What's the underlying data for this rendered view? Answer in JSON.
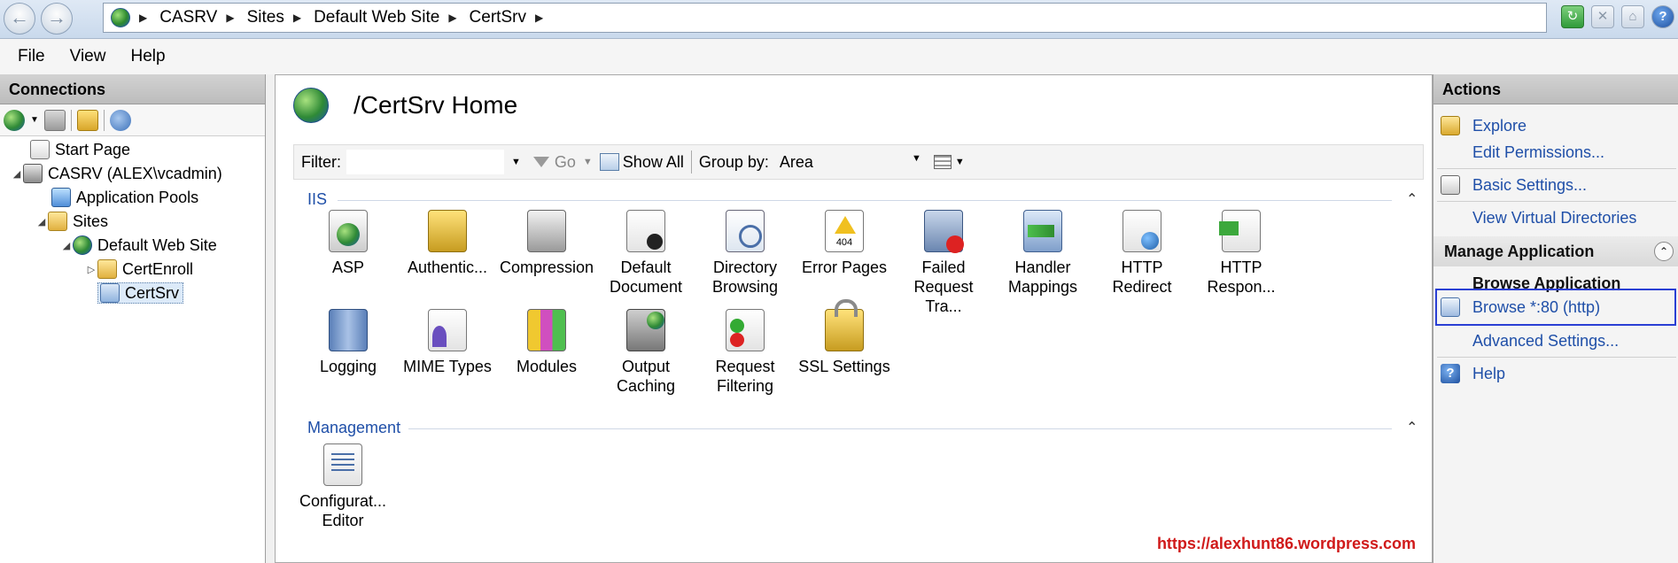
{
  "address_bar": {
    "breadcrumbs": [
      "CASRV",
      "Sites",
      "Default Web Site",
      "CertSrv"
    ]
  },
  "menu": [
    "File",
    "View",
    "Help"
  ],
  "connections": {
    "title": "Connections",
    "tree": [
      {
        "label": "Start Page",
        "icon": "page-icon"
      },
      {
        "label": "CASRV (ALEX\\vcadmin)",
        "icon": "server-icon"
      },
      {
        "label": "Application Pools",
        "icon": "app-pool-icon"
      },
      {
        "label": "Sites",
        "icon": "folder-icon"
      },
      {
        "label": "Default Web Site",
        "icon": "globe-icon"
      },
      {
        "label": "CertEnroll",
        "icon": "folder-icon"
      },
      {
        "label": "CertSrv",
        "icon": "application-icon"
      }
    ]
  },
  "center": {
    "title": "/CertSrv Home",
    "filter": {
      "label": "Filter:",
      "value": "",
      "go_label": "Go",
      "show_all_label": "Show All",
      "group_by_label": "Group by:",
      "group_by_value": "Area"
    },
    "sections": [
      {
        "name": "IIS",
        "features": [
          {
            "label": "ASP",
            "icon": "asp-icon"
          },
          {
            "label": "Authentic...",
            "icon": "authentication-icon"
          },
          {
            "label": "Compression",
            "icon": "compression-icon"
          },
          {
            "label": "Default Document",
            "icon": "default-document-icon"
          },
          {
            "label": "Directory Browsing",
            "icon": "directory-browsing-icon"
          },
          {
            "label": "Error Pages",
            "icon": "error-pages-icon"
          },
          {
            "label": "Failed Request Tra...",
            "icon": "failed-request-tracing-icon"
          },
          {
            "label": "Handler Mappings",
            "icon": "handler-mappings-icon"
          },
          {
            "label": "HTTP Redirect",
            "icon": "http-redirect-icon"
          },
          {
            "label": "HTTP Respon...",
            "icon": "http-response-headers-icon"
          },
          {
            "label": "Logging",
            "icon": "logging-icon"
          },
          {
            "label": "MIME Types",
            "icon": "mime-types-icon"
          },
          {
            "label": "Modules",
            "icon": "modules-icon"
          },
          {
            "label": "Output Caching",
            "icon": "output-caching-icon"
          },
          {
            "label": "Request Filtering",
            "icon": "request-filtering-icon"
          },
          {
            "label": "SSL Settings",
            "icon": "ssl-settings-icon"
          }
        ]
      },
      {
        "name": "Management",
        "features": [
          {
            "label": "Configurat... Editor",
            "icon": "configuration-editor-icon"
          }
        ]
      }
    ],
    "watermark": "https://alexhunt86.wordpress.com",
    "error_badge": "404"
  },
  "actions": {
    "title": "Actions",
    "items": [
      {
        "label": "Explore",
        "icon": "explore-icon"
      },
      {
        "label": "Edit Permissions...",
        "icon": ""
      },
      {
        "label": "Basic Settings...",
        "icon": "basic-settings-icon"
      },
      {
        "label": "View Virtual Directories",
        "icon": ""
      }
    ],
    "manage_application": {
      "title": "Manage Application",
      "browse_heading": "Browse Application",
      "browse_link": "Browse *:80 (http)",
      "advanced": "Advanced Settings..."
    },
    "help": "Help"
  },
  "colors": {
    "link": "#1f4fa8",
    "highlight": "#2a3fd4",
    "watermark": "#d01a1a"
  }
}
